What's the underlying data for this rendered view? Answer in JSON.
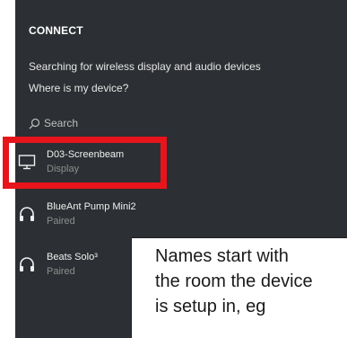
{
  "connect_panel": {
    "title": "CONNECT",
    "status": "Searching for wireless display and audio devices",
    "help_link": "Where is my device?",
    "search": {
      "label": "Search",
      "icon": "search-icon"
    },
    "devices": [
      {
        "name": "D03-Screenbeam",
        "status": "Display",
        "icon": "monitor-icon",
        "selected": true
      },
      {
        "name": "BlueAnt Pump Mini2",
        "status": "Paired",
        "icon": "headphones-icon",
        "selected": false
      },
      {
        "name": "Beats Solo³",
        "status": "Paired",
        "icon": "headphones-icon",
        "selected": false
      }
    ]
  },
  "annotation": {
    "lines": [
      "Names start with",
      "the room the device",
      "is setup in, eg"
    ],
    "highlight_color": "#e8141c"
  },
  "colors": {
    "panel_bg": "#2c2f33",
    "text_primary": "#f0f0f0",
    "text_secondary": "#8e8e8e"
  }
}
